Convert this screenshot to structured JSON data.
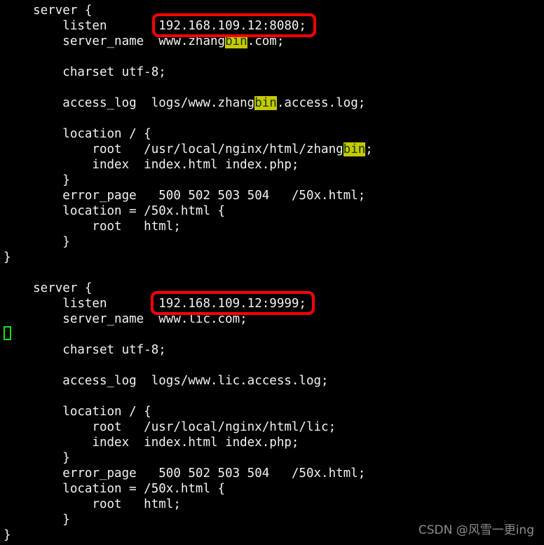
{
  "window": {
    "title": "nginx.conf",
    "background_color": "#000000",
    "text_color": "#f2f2f2"
  },
  "highlight": {
    "term": "bin",
    "background_color": "#c8c800",
    "text_color": "#0a3b0a"
  },
  "annotations": {
    "box_color": "#ff0000",
    "cursor_color": "#13e013",
    "box_1_text": "192.168.109.12:8080;",
    "box_2_text": "192.168.109.12:9999;"
  },
  "watermark": {
    "text": "CSDN @风雪一更ing",
    "color": "#8c8c8c"
  },
  "code": {
    "lines": [
      {
        "pre": "    server {",
        "hl": "",
        "post": ""
      },
      {
        "pre": "        listen       192.168.109.12:8080;",
        "hl": "",
        "post": ""
      },
      {
        "pre": "        server_name  www.zhang",
        "hl": "bin",
        "post": ".com;"
      },
      {
        "pre": "",
        "hl": "",
        "post": ""
      },
      {
        "pre": "        charset utf-8;",
        "hl": "",
        "post": ""
      },
      {
        "pre": "",
        "hl": "",
        "post": ""
      },
      {
        "pre": "        access_log  logs/www.zhang",
        "hl": "bin",
        "post": ".access.log;"
      },
      {
        "pre": "",
        "hl": "",
        "post": ""
      },
      {
        "pre": "        location / {",
        "hl": "",
        "post": ""
      },
      {
        "pre": "            root   /usr/local/nginx/html/zhang",
        "hl": "bin",
        "post": ";"
      },
      {
        "pre": "            index  index.html index.php;",
        "hl": "",
        "post": ""
      },
      {
        "pre": "        }",
        "hl": "",
        "post": ""
      },
      {
        "pre": "        error_page   500 502 503 504   /50x.html;",
        "hl": "",
        "post": ""
      },
      {
        "pre": "        location = /50x.html {",
        "hl": "",
        "post": ""
      },
      {
        "pre": "            root   html;",
        "hl": "",
        "post": ""
      },
      {
        "pre": "        }",
        "hl": "",
        "post": ""
      },
      {
        "pre": "}",
        "hl": "",
        "post": ""
      },
      {
        "pre": "",
        "hl": "",
        "post": ""
      },
      {
        "pre": "    server {",
        "hl": "",
        "post": ""
      },
      {
        "pre": "        listen       192.168.109.12:9999;",
        "hl": "",
        "post": ""
      },
      {
        "pre": "        server_name  www.lic.com;",
        "hl": "",
        "post": ""
      },
      {
        "pre": "",
        "hl": "",
        "post": ""
      },
      {
        "pre": "        charset utf-8;",
        "hl": "",
        "post": ""
      },
      {
        "pre": "",
        "hl": "",
        "post": ""
      },
      {
        "pre": "        access_log  logs/www.lic.access.log;",
        "hl": "",
        "post": ""
      },
      {
        "pre": "",
        "hl": "",
        "post": ""
      },
      {
        "pre": "        location / {",
        "hl": "",
        "post": ""
      },
      {
        "pre": "            root   /usr/local/nginx/html/lic;",
        "hl": "",
        "post": ""
      },
      {
        "pre": "            index  index.html index.php;",
        "hl": "",
        "post": ""
      },
      {
        "pre": "        }",
        "hl": "",
        "post": ""
      },
      {
        "pre": "        error_page   500 502 503 504   /50x.html;",
        "hl": "",
        "post": ""
      },
      {
        "pre": "        location = /50x.html {",
        "hl": "",
        "post": ""
      },
      {
        "pre": "            root   html;",
        "hl": "",
        "post": ""
      },
      {
        "pre": "        }",
        "hl": "",
        "post": ""
      },
      {
        "pre": "}",
        "hl": "",
        "post": ""
      }
    ]
  }
}
